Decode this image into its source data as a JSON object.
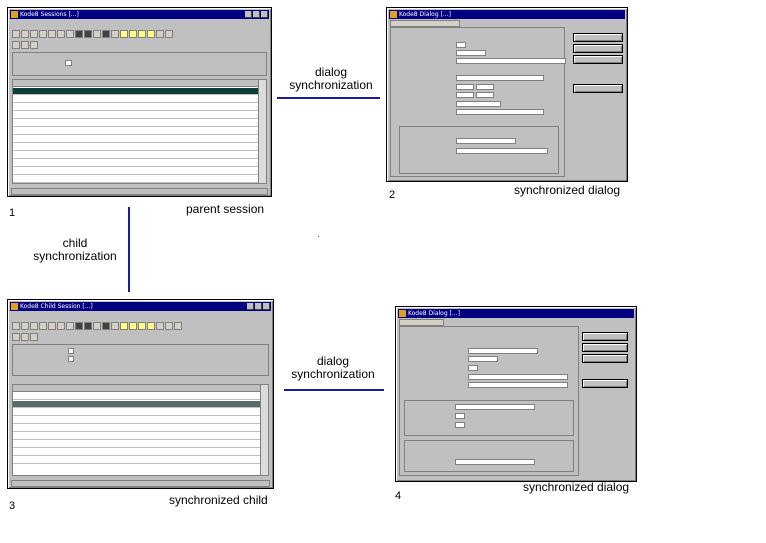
{
  "nodes": {
    "n1": {
      "number": "1",
      "caption": "parent session",
      "title": "Kode8 Sessions [...]"
    },
    "n2": {
      "number": "2",
      "caption": "synchronized dialog",
      "title": "Kode8 Dialog [...]"
    },
    "n3": {
      "number": "3",
      "caption": "synchronized child",
      "title": "Kode8 Child Session [...]"
    },
    "n4": {
      "number": "4",
      "caption": "synchronized dialog",
      "title": "Kode8 Dialog [...]"
    }
  },
  "edges": {
    "e12": {
      "label_line1": "dialog",
      "label_line2": "synchronization"
    },
    "e13": {
      "label_line1": "child",
      "label_line2": "synchronization"
    },
    "e34": {
      "label_line1": "dialog",
      "label_line2": "synchronization"
    }
  },
  "colors": {
    "connector": "#1a1aa6",
    "window_face": "#c0c0c0",
    "title_bar": "#000080",
    "selected_row": "#0d3d3d"
  },
  "icons": {
    "window_icon": "app-window-icon",
    "toolbar_button": "toolbar-button-icon"
  }
}
